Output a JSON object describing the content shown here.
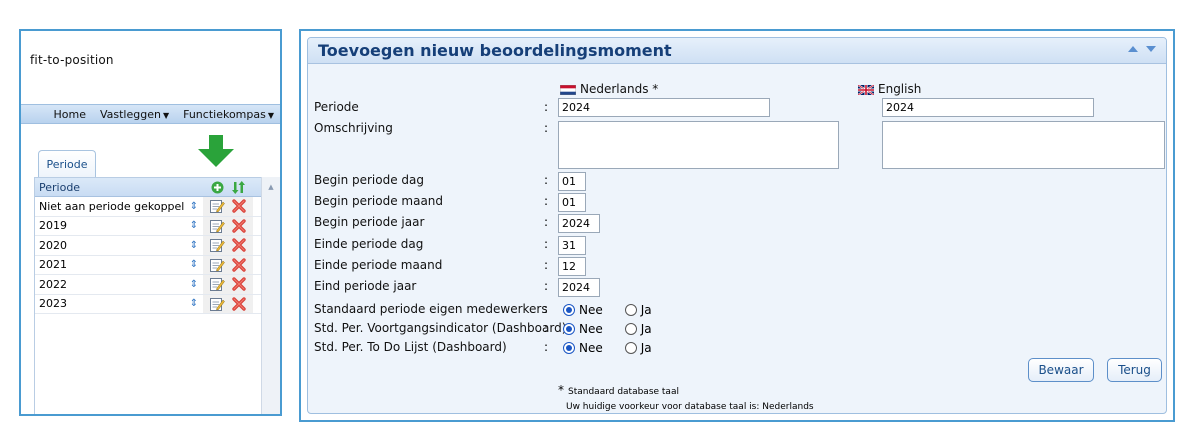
{
  "left": {
    "logo": "fit-to-position",
    "nav": [
      {
        "label": "Home",
        "caret": false
      },
      {
        "label": "Vastleggen",
        "caret": true
      },
      {
        "label": "Functiekompas",
        "caret": true
      }
    ],
    "tab_label": "Periode",
    "grid_header": "Periode",
    "rows": [
      "Niet aan periode gekoppeld",
      "2019",
      "2020",
      "2021",
      "2022",
      "2023"
    ],
    "sort_glyph": "⇕"
  },
  "form": {
    "title": "Toevoegen nieuw beoordelingsmoment",
    "lang_nl": "Nederlands *",
    "lang_en": "English",
    "labels": {
      "periode": "Periode",
      "omschrijving": "Omschrijving",
      "begin_dag": "Begin periode dag",
      "begin_maand": "Begin periode maand",
      "begin_jaar": "Begin periode jaar",
      "einde_dag": "Einde periode dag",
      "einde_maand": "Einde periode maand",
      "eind_jaar": "Eind periode jaar",
      "std_eigen": "Standaard periode eigen medewerkers",
      "std_voortgang": "Std. Per. Voortgangsindicator (Dashboard)",
      "std_todo": "Std. Per. To Do Lijst (Dashboard)"
    },
    "colon": ":",
    "values": {
      "periode_nl": "2024",
      "periode_en": "2024",
      "begin_dag": "01",
      "begin_maand": "01",
      "begin_jaar": "2024",
      "einde_dag": "31",
      "einde_maand": "12",
      "eind_jaar": "2024"
    },
    "radio": {
      "nee": "Nee",
      "ja": "Ja"
    },
    "buttons": {
      "save": "Bewaar",
      "back": "Terug"
    },
    "footnote_star": "*",
    "footnote_1": "Standaard database taal",
    "footnote_2": "Uw huidige voorkeur voor database taal is: Nederlands"
  },
  "colors": {
    "accent": "#4a9bd1",
    "title": "#163f78",
    "arrow_green": "#2aa33a",
    "delete_red": "#d9413a"
  },
  "icons": [
    "green-down-arrow-icon",
    "add-icon",
    "sort-icon",
    "edit-icon",
    "delete-icon",
    "netherlands-flag-icon",
    "uk-flag-icon",
    "collapse-up-icon",
    "collapse-down-icon"
  ]
}
